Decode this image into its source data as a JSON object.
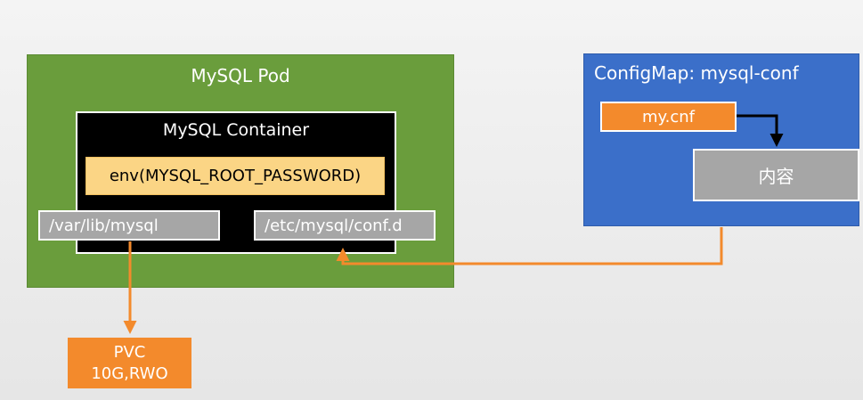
{
  "pod": {
    "title": "MySQL Pod"
  },
  "container": {
    "title": "MySQL Container",
    "env": "env(MYSQL_ROOT_PASSWORD)"
  },
  "mounts": {
    "data_path": "/var/lib/mysql",
    "conf_path": "/etc/mysql/conf.d"
  },
  "pvc": {
    "line1": "PVC",
    "line2": "10G,RWO"
  },
  "configmap": {
    "title": "ConfigMap:  mysql-conf",
    "key": "my.cnf",
    "content": "内容"
  },
  "colors": {
    "pod_green": "#6a9d3c",
    "container_black": "#000000",
    "env_yellow": "#fbd585",
    "mount_gray": "#a6a6a6",
    "pvc_orange": "#f38a2c",
    "configmap_blue": "#3b6fc9",
    "arrow_orange": "#f38a2c",
    "arrow_black": "#000000"
  }
}
